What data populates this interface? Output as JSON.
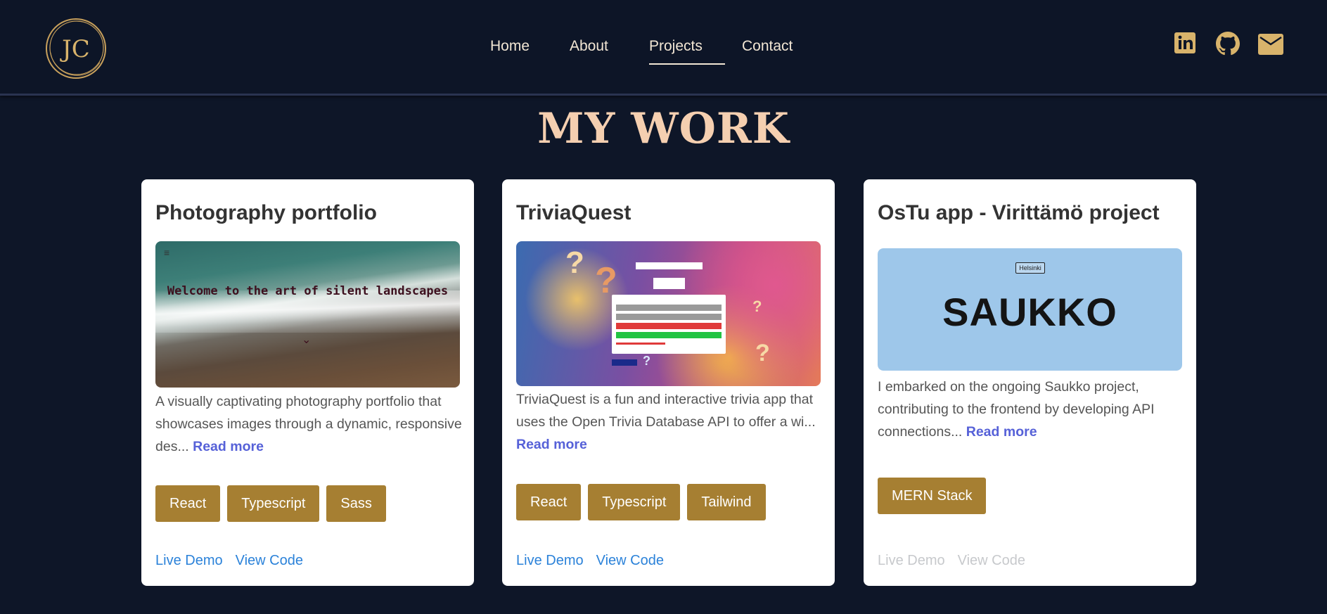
{
  "header": {
    "logo_text": "JC",
    "nav": [
      {
        "label": "Home",
        "active": false
      },
      {
        "label": "About",
        "active": false
      },
      {
        "label": "Projects",
        "active": true
      },
      {
        "label": "Contact",
        "active": false
      }
    ],
    "social_icons": [
      "linkedin-icon",
      "github-icon",
      "mail-icon"
    ],
    "accent_color": "#d8b36b"
  },
  "page_title": "MY WORK",
  "projects": [
    {
      "title": "Photography portfolio",
      "image_caption": "Welcome to the art of silent landscapes",
      "description": "A visually captivating photography portfolio that showcases images through a dynamic, responsive des...",
      "read_more": "Read more",
      "tags": [
        "React",
        "Typescript",
        "Sass"
      ],
      "live_demo": "Live Demo",
      "view_code": "View Code",
      "links_enabled": true
    },
    {
      "title": "TriviaQuest",
      "description": "TriviaQuest is a fun and interactive trivia app that uses the Open Trivia Database API to offer a wi...",
      "read_more": "Read more",
      "tags": [
        "React",
        "Typescript",
        "Tailwind"
      ],
      "live_demo": "Live Demo",
      "view_code": "View Code",
      "links_enabled": true
    },
    {
      "title": "OsTu app - Virittämö project",
      "image_badge": "Helsinki",
      "image_word": "SAUKKO",
      "description": "I embarked on the ongoing Saukko project, contributing to the frontend by developing API connections...",
      "read_more": "Read more",
      "tags": [
        "MERN Stack"
      ],
      "live_demo": "Live Demo",
      "view_code": "View Code",
      "links_enabled": false
    }
  ],
  "colors": {
    "background": "#0e1628",
    "title": "#f5cfb0",
    "tag": "#a67f32",
    "link": "#2b82d9",
    "read_more": "#5661d8"
  }
}
